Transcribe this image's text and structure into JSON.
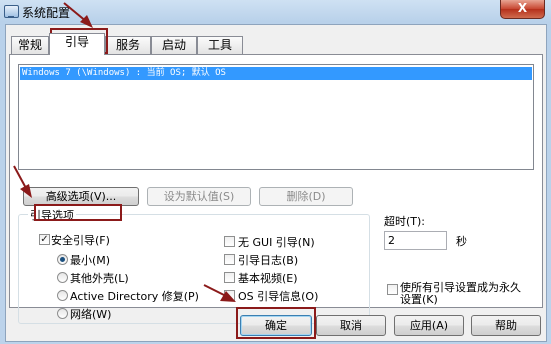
{
  "window": {
    "title": "系统配置",
    "close_label": "X"
  },
  "tabs": [
    {
      "label": "常规",
      "active": false
    },
    {
      "label": "引导",
      "active": true
    },
    {
      "label": "服务",
      "active": false
    },
    {
      "label": "启动",
      "active": false
    },
    {
      "label": "工具",
      "active": false
    }
  ],
  "boot_list": {
    "items": [
      "Windows 7 (\\Windows) : 当前 OS; 默认 OS"
    ]
  },
  "boot_buttons": {
    "advanced": "高级选项(V)...",
    "set_default": "设为默认值(S)",
    "delete": "删除(D)"
  },
  "boot_options": {
    "group_label": "引导选项",
    "safe_boot": {
      "label": "安全引导(F)",
      "checked": true
    },
    "radios": [
      {
        "label": "最小(M)",
        "selected": true
      },
      {
        "label": "其他外壳(L)",
        "selected": false
      },
      {
        "label": "Active Directory 修复(P)",
        "selected": false
      },
      {
        "label": "网络(W)",
        "selected": false
      }
    ],
    "checks": [
      {
        "label": "无 GUI 引导(N)",
        "checked": false
      },
      {
        "label": "引导日志(B)",
        "checked": false
      },
      {
        "label": "基本视频(E)",
        "checked": false
      },
      {
        "label": "OS 引导信息(O)",
        "checked": false
      }
    ]
  },
  "timeout": {
    "label": "超时(T):",
    "value": "2",
    "unit": "秒"
  },
  "permanent": {
    "label_line1": "使所有引导设置成为永久",
    "label_line2": "设置(K)",
    "checked": false
  },
  "footer": {
    "ok": "确定",
    "cancel": "取消",
    "apply": "应用(A)",
    "help": "帮助"
  },
  "annotation_color": "#8b1a1a"
}
